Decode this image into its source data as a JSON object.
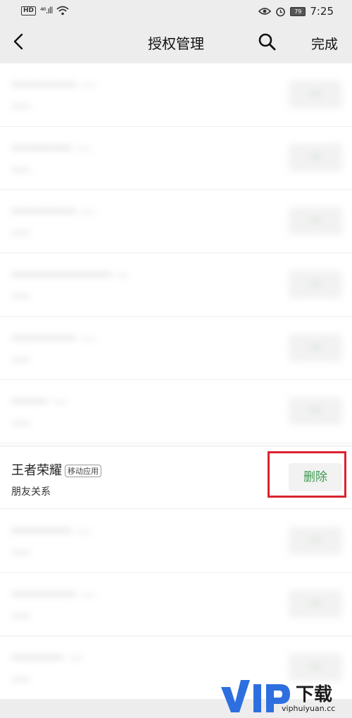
{
  "status_bar": {
    "hd": "HD",
    "signal": "⁴⁶.ıll",
    "battery": "79",
    "time": "7:25"
  },
  "header": {
    "title": "授权管理",
    "done": "完成"
  },
  "list": {
    "blurred_items": [
      {
        "name": "················",
        "tag": "······",
        "sub": "······",
        "btn": "···"
      },
      {
        "name": "···············",
        "tag": "······",
        "sub": "······",
        "btn": "···"
      },
      {
        "name": "················",
        "tag": "······",
        "sub": "······",
        "btn": "···"
      },
      {
        "name": "·························",
        "tag": "·····",
        "sub": "······",
        "btn": "···"
      },
      {
        "name": "················",
        "tag": "······",
        "sub": "······",
        "btn": "···"
      },
      {
        "name": "·········",
        "tag": "······",
        "sub": "······",
        "btn": "···"
      },
      {
        "name": "···············",
        "tag": "······",
        "sub": "······",
        "btn": "···"
      },
      {
        "name": "················",
        "tag": "······",
        "sub": "······",
        "btn": "···"
      },
      {
        "name": "·············",
        "tag": "······",
        "sub": "······",
        "btn": "···"
      }
    ],
    "focus_item": {
      "name": "王者荣耀",
      "tag": "移动应用",
      "sub": "朋友关系",
      "button": "删除"
    }
  },
  "watermark": {
    "cn": "下载",
    "url": "viphuiyuan.cc"
  },
  "colors": {
    "accent_green": "#3c9a4e",
    "highlight_red": "#d9232e"
  },
  "icons": [
    "back-arrow-icon",
    "search-icon",
    "eye-icon",
    "alarm-icon",
    "wifi-icon"
  ]
}
